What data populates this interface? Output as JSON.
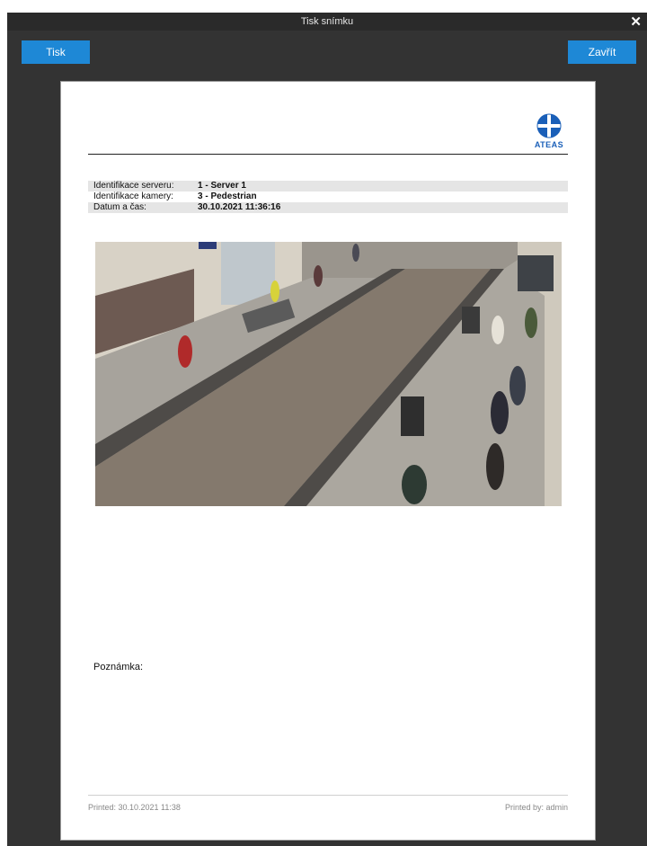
{
  "window": {
    "title": "Tisk snímku",
    "close_icon": "close-icon"
  },
  "toolbar": {
    "print_label": "Tisk",
    "close_label": "Zavřít"
  },
  "colors": {
    "accent": "#1e88d6",
    "window_bg": "#333333",
    "logo_blue": "#1a5fb8"
  },
  "report": {
    "logo_text": "ATEAS",
    "info": [
      {
        "label": "Identifikace serveru:",
        "value": "1 - Server 1"
      },
      {
        "label": "Identifikace kamery:",
        "value": "3 - Pedestrian"
      },
      {
        "label": "Datum a čas:",
        "value": "30.10.2021 11:36:16"
      }
    ],
    "note_label": "Poznámka:",
    "footer_left": "Printed: 30.10.2021 11:38",
    "footer_right": "Printed by: admin"
  }
}
